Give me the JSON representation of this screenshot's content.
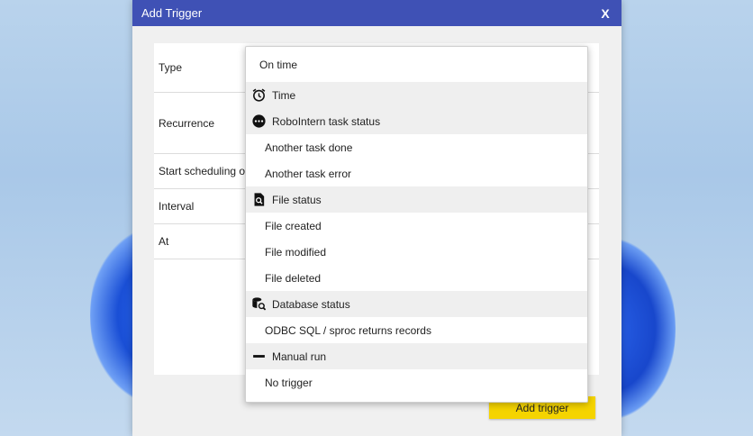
{
  "dialog": {
    "title": "Add Trigger",
    "close_label": "X"
  },
  "form": {
    "rows": [
      {
        "label": "Type"
      },
      {
        "label": "Recurrence"
      },
      {
        "label": "Start scheduling on"
      },
      {
        "label": "Interval"
      },
      {
        "label": "At"
      }
    ]
  },
  "add_button_label": "Add trigger",
  "dropdown": {
    "current": "On time",
    "groups": [
      {
        "label": "Time",
        "icon": "alarm-clock-icon",
        "items": []
      },
      {
        "label": "RoboIntern task status",
        "icon": "more-dots-icon",
        "items": [
          "Another task done",
          "Another task error"
        ]
      },
      {
        "label": "File status",
        "icon": "file-search-icon",
        "items": [
          "File created",
          "File modified",
          "File deleted"
        ]
      },
      {
        "label": "Database status",
        "icon": "database-search-icon",
        "items": [
          "ODBC SQL / sproc returns records"
        ]
      },
      {
        "label": "Manual run",
        "icon": "minus-icon",
        "items": [
          "No trigger"
        ]
      }
    ]
  },
  "colors": {
    "titlebar": "#3f51b5",
    "button": "#f5d400",
    "group_bg": "#efefef"
  }
}
